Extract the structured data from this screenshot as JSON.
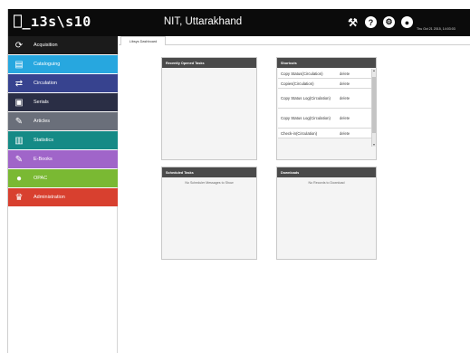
{
  "header": {
    "logo_text": "⎕_ıЗѕ\\ѕ10",
    "org_title": "NIT, Uttarakhand",
    "datetime": "Thu Oct 21 2015, 14:03:03",
    "icons": [
      "tools-icon",
      "help-icon",
      "settings-icon",
      "user-icon"
    ]
  },
  "sidebar": {
    "items": [
      {
        "label": "Acquisition",
        "icon": "acquisition-icon",
        "glyph": "⟳",
        "color": "#1b1b1b"
      },
      {
        "label": "Cataloguing",
        "icon": "catalog-icon",
        "glyph": "▤",
        "color": "#27a7df"
      },
      {
        "label": "Circulation",
        "icon": "circulation-icon",
        "glyph": "⇄",
        "color": "#37438f"
      },
      {
        "label": "Serials",
        "icon": "serials-icon",
        "glyph": "▣",
        "color": "#2a2e45"
      },
      {
        "label": "Articles",
        "icon": "articles-icon",
        "glyph": "✎",
        "color": "#6a6f7a"
      },
      {
        "label": "Statistics",
        "icon": "statistics-icon",
        "glyph": "▥",
        "color": "#158a86"
      },
      {
        "label": "E-Books",
        "icon": "ebooks-icon",
        "glyph": "✎",
        "color": "#a065c9"
      },
      {
        "label": "OPAC",
        "icon": "opac-icon",
        "glyph": "●",
        "color": "#7ab933"
      },
      {
        "label": "Administration",
        "icon": "admin-crown-icon",
        "glyph": "♛",
        "color": "#d8402f"
      }
    ]
  },
  "tabs": {
    "dashboard": "Libsys Dashboard"
  },
  "panels": {
    "recent": {
      "title": "Recently Opened Tasks"
    },
    "shortcuts": {
      "title": "Shortcuts",
      "rows": [
        {
          "name": "Copy Status(Circulation)",
          "action": "delete"
        },
        {
          "name": "Copies(Circulation)",
          "action": "delete"
        },
        {
          "name": "Copy Status Log(Circulation)",
          "action": "delete"
        },
        {
          "name": "Copy Status Log(Circulation)",
          "action": "delete"
        },
        {
          "name": "Check-in(Circulation)",
          "action": "delete"
        }
      ]
    },
    "scheduled": {
      "title": "Scheduled Tasks",
      "message": "No Scheduler Messages to Show"
    },
    "downloads": {
      "title": "Downloads",
      "message": "No Records to Download"
    }
  },
  "colors": {
    "topbar": "#0b0b0b",
    "panel_header": "#4a4a4a"
  }
}
